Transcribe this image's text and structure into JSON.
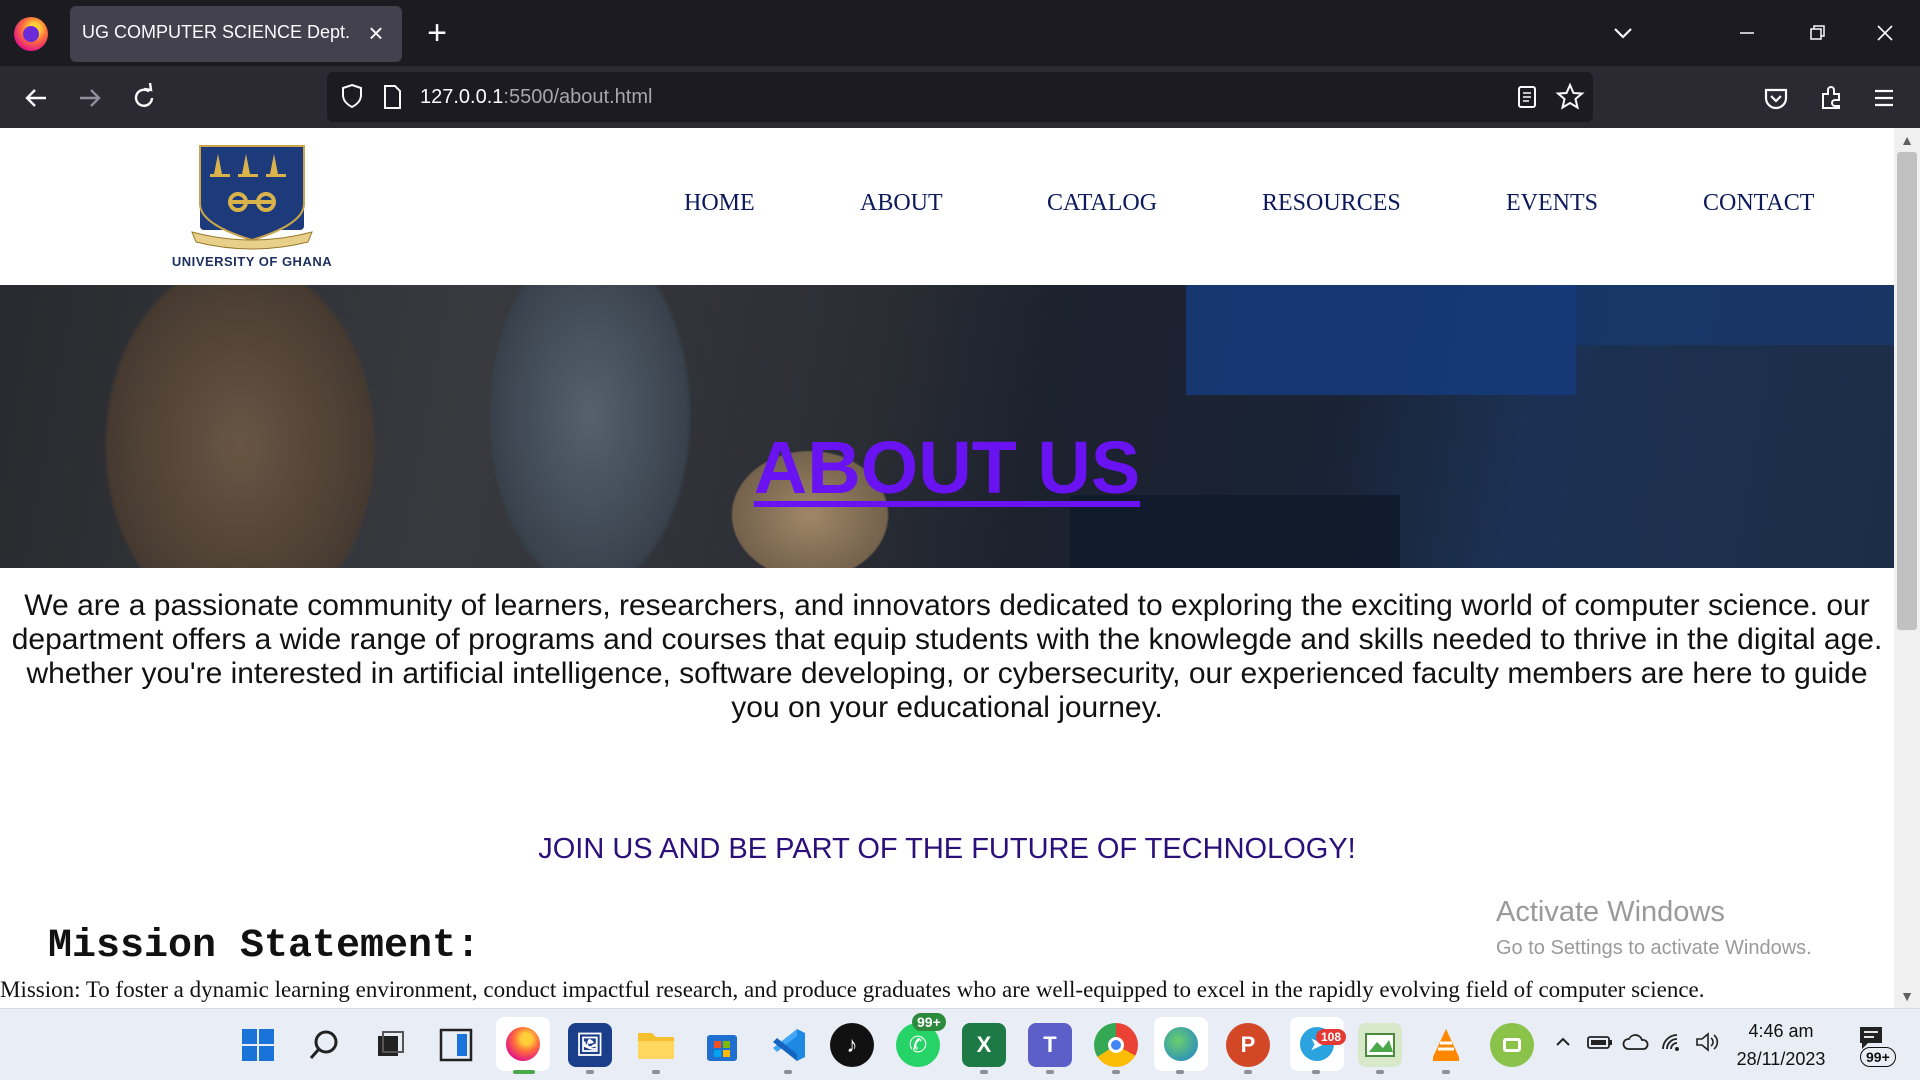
{
  "browser": {
    "tab_title": "UG COMPUTER SCIENCE Dept.",
    "url_host": "127.0.0.1",
    "url_path": ":5500/about.html"
  },
  "site": {
    "logo_text": "UNIVERSITY OF GHANA",
    "logo_motto": "INTEGRI PROCEDAMUS",
    "nav": [
      "HOME",
      "ABOUT",
      "CATALOG",
      "RESOURCES",
      "EVENTS",
      "CONTACT"
    ],
    "hero_title": "ABOUT US",
    "intro": "We are a passionate community of learners, researchers, and innovators dedicated to exploring the exciting world of computer science. our department offers a wide range of programs and courses that equip students with the knowlegde and skills needed to thrive in the digital age. whether you're interested in artificial intelligence, software developing, or cybersecurity, our experienced faculty members are here to guide you on your educational journey.",
    "join": "JOIN US AND BE PART OF THE FUTURE OF TECHNOLOGY!",
    "mission_heading": "Mission Statement:",
    "mission_text": "Mission: To foster a dynamic learning environment, conduct impactful research, and produce graduates who are well-equipped to excel in the rapidly evolving field of computer science."
  },
  "watermark": {
    "line1": "Activate Windows",
    "line2": "Go to Settings to activate Windows."
  },
  "taskbar": {
    "whatsapp_badge": "99+",
    "telegram_badge": "108",
    "notification_badge": "99+",
    "time": "4:46 am",
    "date": "28/11/2023"
  },
  "colors": {
    "hero_title": "#6a13f2",
    "nav_text": "#0c1a5b",
    "join_text": "#2b0f7a"
  }
}
